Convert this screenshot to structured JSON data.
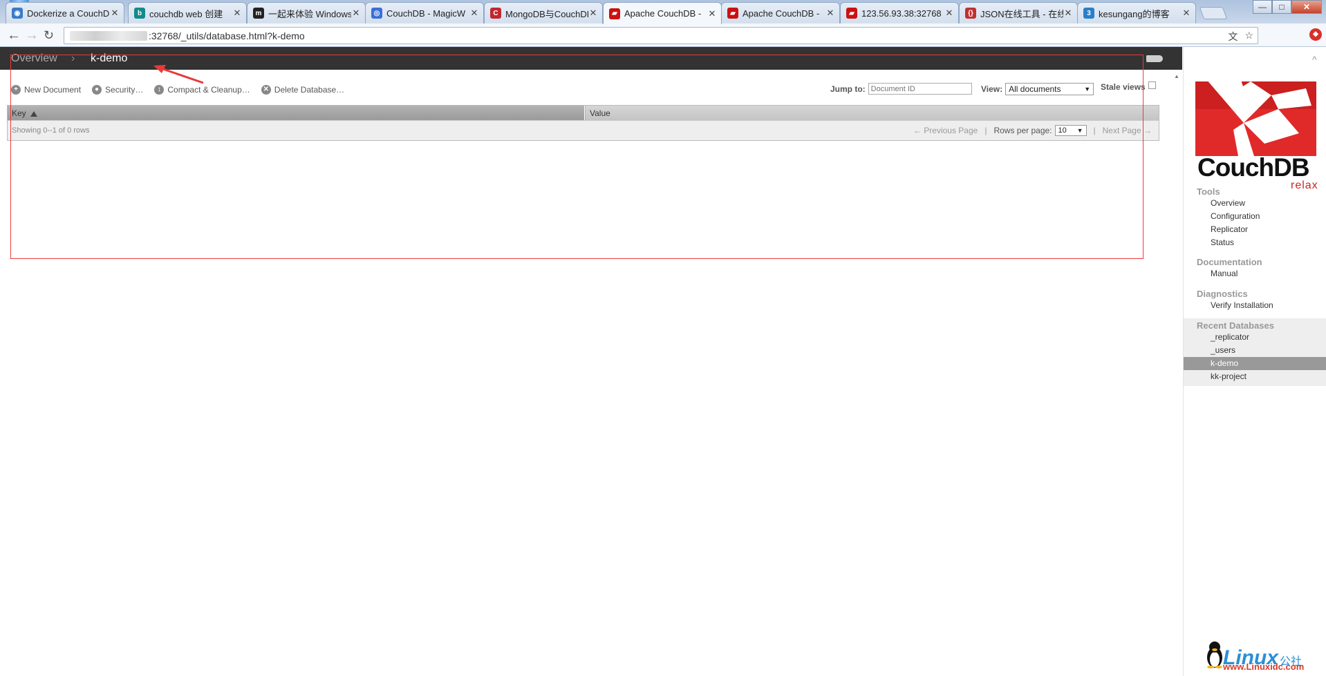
{
  "browser": {
    "tabs": [
      {
        "title": "Dockerize a CouchDB",
        "favicon_color": "#3a7bc8",
        "favicon_glyph": "◉"
      },
      {
        "title": "couchdb web 创建",
        "favicon_color": "#138a8a",
        "favicon_glyph": "b"
      },
      {
        "title": "一起来体验 Windows",
        "favicon_color": "#222222",
        "favicon_glyph": "m"
      },
      {
        "title": "CouchDB - MagicW",
        "favicon_color": "#3b6fd8",
        "favicon_glyph": "◎"
      },
      {
        "title": "MongoDB与CouchDB",
        "favicon_color": "#c0282e",
        "favicon_glyph": "C"
      },
      {
        "title": "Apache CouchDB -",
        "favicon_color": "#cc1111",
        "favicon_glyph": "▰"
      },
      {
        "title": "Apache CouchDB -",
        "favicon_color": "#cc1111",
        "favicon_glyph": "▰"
      },
      {
        "title": "123.56.93.38:32768",
        "favicon_color": "#cc1111",
        "favicon_glyph": "▰"
      },
      {
        "title": "JSON在线工具 - 在线",
        "favicon_color": "#c03030",
        "favicon_glyph": "{}"
      },
      {
        "title": "kesungang的博客",
        "favicon_color": "#2a7fc8",
        "favicon_glyph": "3"
      }
    ],
    "active_tab_index": 5,
    "close_glyph": "✕",
    "url_suffix": ":32768/_utils/database.html?k-demo",
    "back_glyph": "←",
    "forward_glyph": "→",
    "reload_glyph": "↻",
    "translate_glyph": "文",
    "star_glyph": "☆",
    "ext_glyph": "◆",
    "win_min": "—",
    "win_max": "□",
    "win_close": "✕"
  },
  "header": {
    "breadcrumb_overview": "Overview",
    "breadcrumb_sep": "›",
    "breadcrumb_current": "k-demo"
  },
  "actions": {
    "new_document": "New Document",
    "security": "Security…",
    "compact": "Compact & Cleanup…",
    "delete": "Delete Database…",
    "new_icon": "+",
    "security_icon": "●",
    "compact_icon": "↕",
    "delete_icon": "✕"
  },
  "controls": {
    "jump_label": "Jump to:",
    "jump_placeholder": "Document ID",
    "view_label": "View:",
    "view_value": "All documents",
    "stale_label": "Stale views",
    "dropdown_glyph": "▼"
  },
  "table": {
    "col_key": "Key",
    "col_value": "Value",
    "showing": "Showing 0--1 of 0 rows",
    "prev_page": "← Previous Page",
    "rows_label": "Rows per page:",
    "rows_value": "10",
    "next_page": "Next Page →",
    "pipe": "|"
  },
  "sidebar": {
    "logo_text": "CouchDB",
    "logo_tagline": "relax",
    "tools_title": "Tools",
    "tools": [
      "Overview",
      "Configuration",
      "Replicator",
      "Status"
    ],
    "docs_title": "Documentation",
    "docs": [
      "Manual"
    ],
    "diag_title": "Diagnostics",
    "diag": [
      "Verify Installation"
    ],
    "recent_title": "Recent Databases",
    "recent": [
      "_replicator",
      "_users",
      "k-demo",
      "kk-project"
    ],
    "recent_selected_index": 2,
    "caret": "^"
  },
  "watermark": {
    "brand": "Linux",
    "brand_cn": "公社",
    "url": "www.Linuxidc.com"
  }
}
